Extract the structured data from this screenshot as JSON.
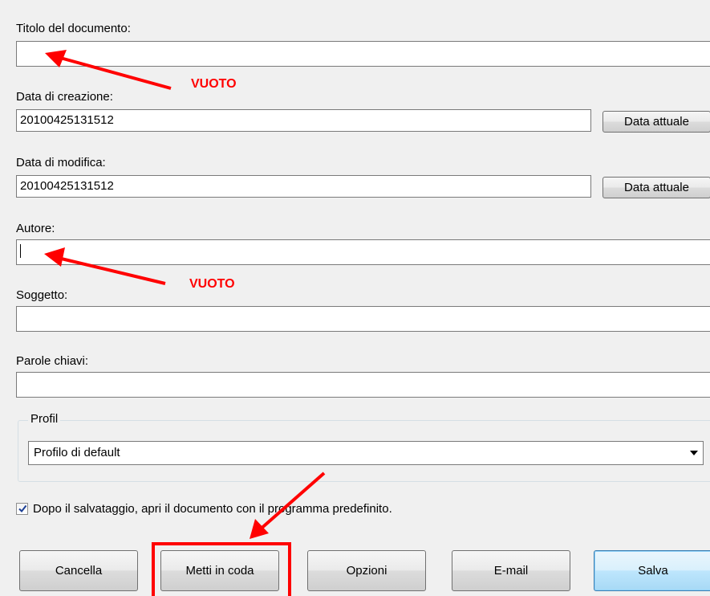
{
  "form": {
    "title_label": "Titolo del documento:",
    "title_value": "",
    "creation_label": "Data di creazione:",
    "creation_value": "20100425131512",
    "modified_label": "Data di modifica:",
    "modified_value": "20100425131512",
    "current_date_label": "Data attuale",
    "author_label": "Autore:",
    "author_value": "",
    "subject_label": "Soggetto:",
    "subject_value": "",
    "keywords_label": "Parole chiavi:",
    "keywords_value": ""
  },
  "profile": {
    "group_label": "Profil",
    "selected": "Profilo di default"
  },
  "option": {
    "open_after_save_label": "Dopo il salvataggio, apri il documento con il programma predefinito.",
    "open_after_save_checked": true
  },
  "buttons": {
    "cancel": "Cancella",
    "queue": "Metti in coda",
    "options": "Opzioni",
    "email": "E-mail",
    "save": "Salva"
  },
  "annotations": {
    "empty_note": "VUOTO",
    "color": "#ff0000"
  },
  "colors": {
    "background": "#f0f0f0",
    "default_button": "#bee6fd",
    "annotation": "#ff0000"
  },
  "icons": {
    "check": "check-icon",
    "dropdown": "chevron-down-icon"
  }
}
